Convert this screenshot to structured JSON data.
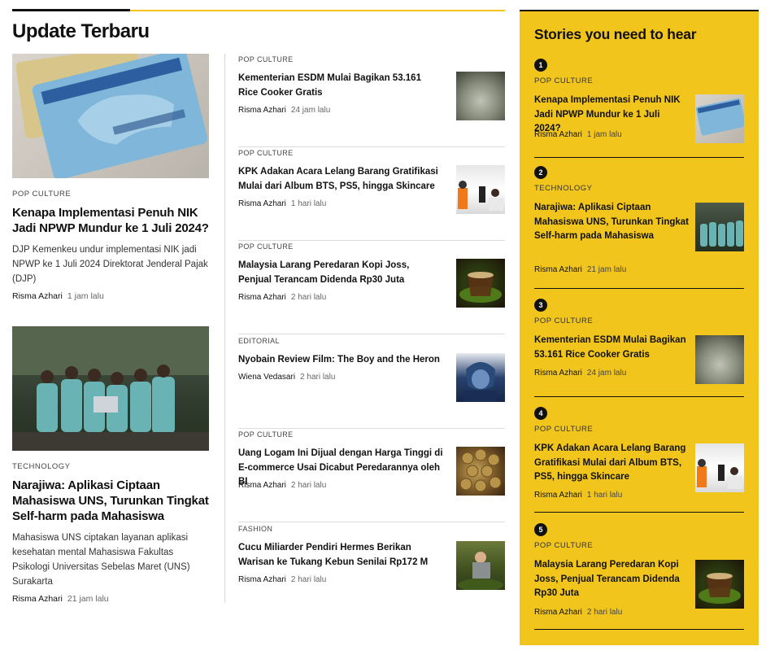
{
  "section_title": "Update Terbaru",
  "featured": [
    {
      "category": "POP CULTURE",
      "title": "Kenapa Implementasi Penuh NIK Jadi NPWP Mundur ke 1 Juli 2024?",
      "excerpt": "DJP Kemenkeu undur implementasi NIK jadi NPWP ke 1 Juli 2024 Direktorat Jenderal Pajak (DJP)",
      "author": "Risma Azhari",
      "time": "1 jam lalu",
      "image": "ktp-card-photo"
    },
    {
      "category": "TECHNOLOGY",
      "title": "Narajiwa: Aplikasi Ciptaan Mahasiswa UNS, Turunkan Tingkat Self-harm pada Mahasiswa",
      "excerpt": "Mahasiswa UNS ciptakan layanan aplikasi kesehatan mental Mahasiswa Fakultas Psikologi Universitas Sebelas Maret (UNS) Surakarta",
      "author": "Risma Azhari",
      "time": "21 jam lalu",
      "image": "students-group-photo"
    }
  ],
  "middle": [
    {
      "category": "POP CULTURE",
      "title": "Kementerian ESDM Mulai Bagikan 53.161 Rice Cooker Gratis",
      "author": "Risma Azhari",
      "time": "24 jam lalu",
      "image": "rice-cooker-photo"
    },
    {
      "category": "POP CULTURE",
      "title": "KPK Adakan Acara Lelang Barang Gratifikasi Mulai dari Album BTS, PS5, hingga Skincare",
      "author": "Risma Azhari",
      "time": "1 hari lalu",
      "image": "kpk-press-photo"
    },
    {
      "category": "POP CULTURE",
      "title": "Malaysia Larang Peredaran Kopi Joss, Penjual Terancam Didenda Rp30 Juta",
      "author": "Risma Azhari",
      "time": "2 hari lalu",
      "image": "kopi-joss-photo"
    },
    {
      "category": "EDITORIAL",
      "title": "Nyobain Review Film: The Boy and the Heron",
      "author": "Wiena Vedasari",
      "time": "2 hari lalu",
      "image": "anime-poster"
    },
    {
      "category": "POP CULTURE",
      "title": "Uang Logam Ini Dijual dengan Harga Tinggi di E-commerce Usai Dicabut Peredarannya oleh BI",
      "author": "Risma Azhari",
      "time": "2 hari lalu",
      "image": "coins-photo"
    },
    {
      "category": "FASHION",
      "title": "Cucu Miliarder Pendiri Hermes Berikan Warisan ke Tukang Kebun Senilai Rp172 M",
      "author": "Risma Azhari",
      "time": "2 hari lalu",
      "image": "gardener-photo"
    }
  ],
  "sidebar": {
    "heading": "Stories you need to hear",
    "items": [
      {
        "num": "1",
        "category": "POP CULTURE",
        "title": "Kenapa Implementasi Penuh NIK Jadi NPWP Mundur ke 1 Juli 2024?",
        "author": "Risma Azhari",
        "time": "1 jam lalu",
        "image": "ktp-card-photo"
      },
      {
        "num": "2",
        "category": "TECHNOLOGY",
        "title": "Narajiwa: Aplikasi Ciptaan Mahasiswa UNS, Turunkan Tingkat Self-harm pada Mahasiswa",
        "author": "Risma Azhari",
        "time": "21 jam lalu",
        "image": "students-group-photo"
      },
      {
        "num": "3",
        "category": "POP CULTURE",
        "title": "Kementerian ESDM Mulai Bagikan 53.161 Rice Cooker Gratis",
        "author": "Risma Azhari",
        "time": "24 jam lalu",
        "image": "rice-cooker-photo"
      },
      {
        "num": "4",
        "category": "POP CULTURE",
        "title": "KPK Adakan Acara Lelang Barang Gratifikasi Mulai dari Album BTS, PS5, hingga Skincare",
        "author": "Risma Azhari",
        "time": "1 hari lalu",
        "image": "kpk-press-photo"
      },
      {
        "num": "5",
        "category": "POP CULTURE",
        "title": "Malaysia Larang Peredaran Kopi Joss, Penjual Terancam Didenda Rp30 Juta",
        "author": "Risma Azhari",
        "time": "2 hari lalu",
        "image": "kopi-joss-photo"
      }
    ]
  },
  "colors": {
    "accent": "#f2c51d",
    "text": "#111111",
    "divider": "#dcdcdc"
  }
}
